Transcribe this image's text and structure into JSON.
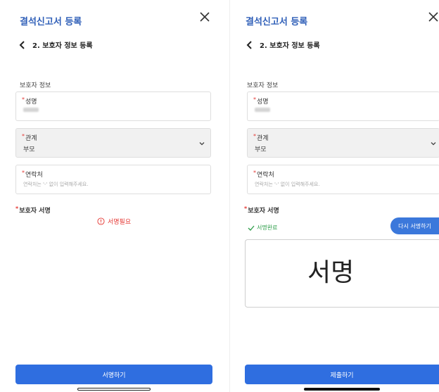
{
  "left": {
    "app_title": "결석신고서 등록",
    "step_title": "2. 보호자 정보 등록",
    "section_label": "보호자 정보",
    "name_label": "성명",
    "relation_label": "관계",
    "relation_value": "부모",
    "contact_label": "연락처",
    "contact_placeholder": "연락처는 '-' 없이 입력해주세요.",
    "signature_label": "보호자 서명",
    "signature_required": "서명필요",
    "sign_button": "서명하기"
  },
  "right": {
    "app_title": "결석신고서 등록",
    "step_title": "2. 보호자 정보 등록",
    "section_label": "보호자 정보",
    "name_label": "성명",
    "relation_label": "관계",
    "relation_value": "부모",
    "contact_label": "연락처",
    "contact_placeholder": "연락처는 '-' 없이 입력해주세요.",
    "signature_label": "보호자 서명",
    "signature_complete": "서명완료",
    "resign_button": "다시 서명하기",
    "signature_text": "서명",
    "submit_button": "제출하기"
  },
  "colors": {
    "brand_blue": "#2f6ee0",
    "title_blue": "#2f5fb8",
    "required_red": "#e53935",
    "success_green": "#2e9e4a"
  },
  "icons": [
    "close-icon",
    "chevron-left-icon",
    "chevron-down-icon",
    "alert-circle-icon",
    "check-icon"
  ]
}
